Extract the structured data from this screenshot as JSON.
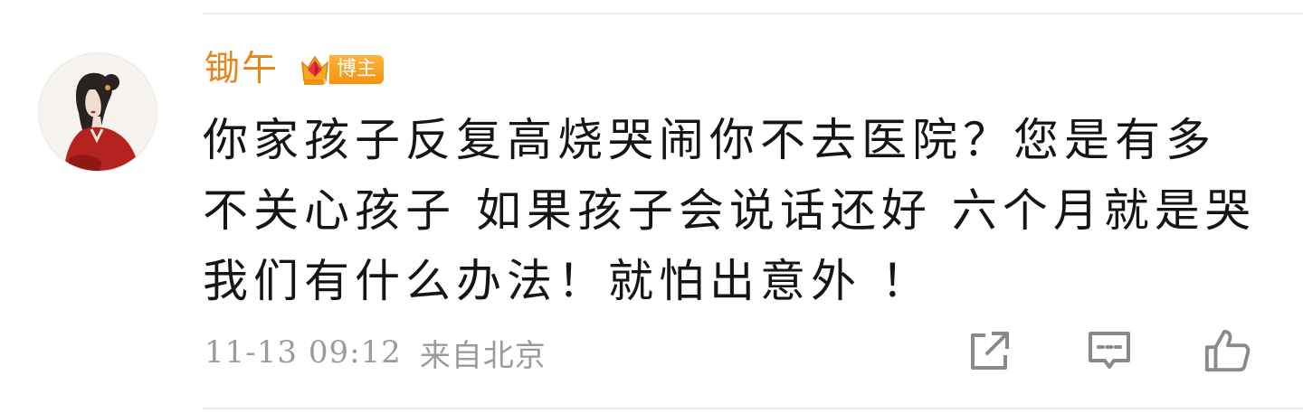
{
  "comment": {
    "author": {
      "name": "锄午",
      "badge": "博主",
      "avatar_icon": "avatar-woman-red-dress"
    },
    "text": "你家孩子反复高烧哭闹你不去医院？您是有多不关心孩子 如果孩子会说话还好 六个月就是哭我们有什么办法！就怕出意外 ！",
    "timestamp": "11-13 09:12",
    "location": "来自北京"
  },
  "actions": {
    "share_icon": "share-icon",
    "reply_icon": "comment-icon",
    "like_icon": "thumbs-up-icon"
  },
  "colors": {
    "author_name": "#e8861c",
    "badge_bg": "#f59112",
    "text": "#151515",
    "meta": "#9b9b9b",
    "icon": "#8a8a8a"
  }
}
